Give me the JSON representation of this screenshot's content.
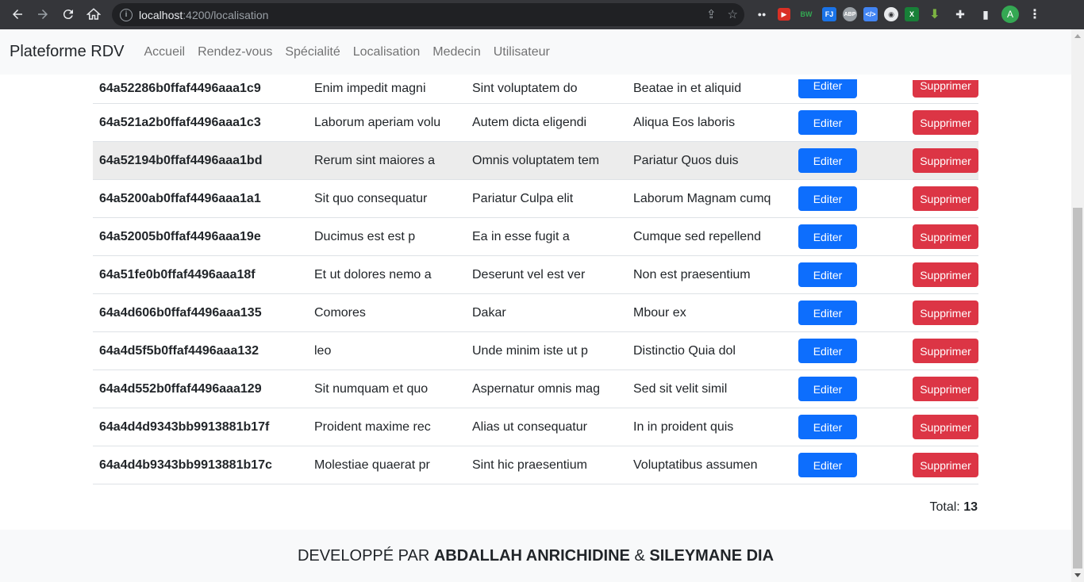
{
  "browser": {
    "url_host": "localhost",
    "url_path": ":4200/localisation",
    "avatar_letter": "A",
    "extensions": [
      "BW",
      "FJ",
      "ABP",
      "",
      "",
      "X",
      "",
      ""
    ]
  },
  "navbar": {
    "brand": "Plateforme RDV",
    "links": [
      "Accueil",
      "Rendez-vous",
      "Spécialité",
      "Localisation",
      "Medecin",
      "Utilisateur"
    ]
  },
  "table": {
    "rows": [
      {
        "id": "64a52286b0ffaf4496aaa1c9",
        "a": "Enim impedit magni",
        "b": "Sint voluptatem do",
        "c": "Beatae in et aliquid"
      },
      {
        "id": "64a521a2b0ffaf4496aaa1c3",
        "a": "Laborum aperiam volu",
        "b": "Autem dicta eligendi",
        "c": "Aliqua Eos laboris"
      },
      {
        "id": "64a52194b0ffaf4496aaa1bd",
        "a": "Rerum sint maiores a",
        "b": "Omnis voluptatem tem",
        "c": "Pariatur Quos duis"
      },
      {
        "id": "64a5200ab0ffaf4496aaa1a1",
        "a": "Sit quo consequatur",
        "b": "Pariatur Culpa elit",
        "c": "Laborum Magnam cumq"
      },
      {
        "id": "64a52005b0ffaf4496aaa19e",
        "a": "Ducimus est est p",
        "b": "Ea in esse fugit a",
        "c": "Cumque sed repellend"
      },
      {
        "id": "64a51fe0b0ffaf4496aaa18f",
        "a": "Et ut dolores nemo a",
        "b": "Deserunt vel est ver",
        "c": "Non est praesentium"
      },
      {
        "id": "64a4d606b0ffaf4496aaa135",
        "a": "Comores",
        "b": "Dakar",
        "c": "Mbour ex"
      },
      {
        "id": "64a4d5f5b0ffaf4496aaa132",
        "a": "leo",
        "b": "Unde minim iste ut p",
        "c": "Distinctio Quia dol"
      },
      {
        "id": "64a4d552b0ffaf4496aaa129",
        "a": "Sit numquam et quo",
        "b": "Aspernatur omnis mag",
        "c": "Sed sit velit simil"
      },
      {
        "id": "64a4d4d9343bb9913881b17f",
        "a": "Proident maxime rec",
        "b": "Alias ut consequatur",
        "c": "In in proident quis"
      },
      {
        "id": "64a4d4b9343bb9913881b17c",
        "a": "Molestiae quaerat pr",
        "b": "Sint hic praesentium",
        "c": "Voluptatibus assumen"
      }
    ],
    "edit_label": "Editer",
    "delete_label": "Supprimer"
  },
  "total": {
    "label": "Total:",
    "value": "13"
  },
  "footer": {
    "prefix": "DEVELOPPÉ PAR",
    "author1": "ABDALLAH ANRICHIDINE",
    "amp": "&",
    "author2": "SILEYMANE DIA"
  },
  "colors": {
    "primary": "#0d6efd",
    "danger": "#dc3545",
    "chrome": "#35363a"
  }
}
